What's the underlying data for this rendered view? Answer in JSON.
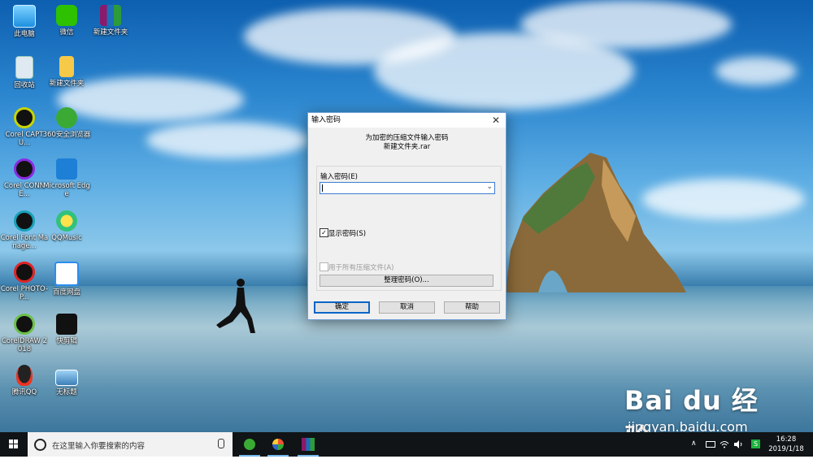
{
  "desktop": {
    "icons": [
      {
        "label": "此电脑"
      },
      {
        "label": "微信"
      },
      {
        "label": "新建文件夹"
      },
      {
        "label": "回收站"
      },
      {
        "label": "新建文件夹"
      },
      {
        "label": "Corel CAPTU..."
      },
      {
        "label": "360安全浏览器"
      },
      {
        "label": "Corel CONNE..."
      },
      {
        "label": "Microsoft Edge"
      },
      {
        "label": "Corel Font Manage..."
      },
      {
        "label": "QQMusic"
      },
      {
        "label": "Corel PHOTO-P..."
      },
      {
        "label": "百度网盘"
      },
      {
        "label": "CorelDRAW 2018"
      },
      {
        "label": "快剪辑"
      },
      {
        "label": "腾讯QQ"
      },
      {
        "label": "无标题"
      }
    ]
  },
  "dialog": {
    "title": "输入密码",
    "close": "✕",
    "prompt_line1": "为加密的压缩文件输入密码",
    "prompt_line2": "新建文件夹.rar",
    "password_label": "输入密码(E)",
    "password_value": "",
    "dropdown_arrow": "⌄",
    "show_password": {
      "label": "显示密码(S)",
      "checked": true,
      "mark": "✓"
    },
    "use_for_all": {
      "label": "用于所有压缩文件(A)",
      "checked": false,
      "enabled": false
    },
    "organize_button": "整理密码(O)...",
    "ok_button": "确定",
    "cancel_button": "取消",
    "help_button": "帮助"
  },
  "taskbar": {
    "search_placeholder": "在这里输入你要搜索的内容",
    "apps": [
      "360安全浏览器",
      "Corel",
      "WinRAR"
    ],
    "tray": {
      "up_arrow": "∧",
      "ime": "S"
    },
    "time": "16:28",
    "date": "2019/1/18"
  },
  "watermark": {
    "brand": "Bai du 经验",
    "url": "jingyan.baidu.com"
  },
  "colors": {
    "accent": "#0a64c8",
    "dialog_bg": "#f0f0f0",
    "taskbar_bg": "#101416"
  }
}
